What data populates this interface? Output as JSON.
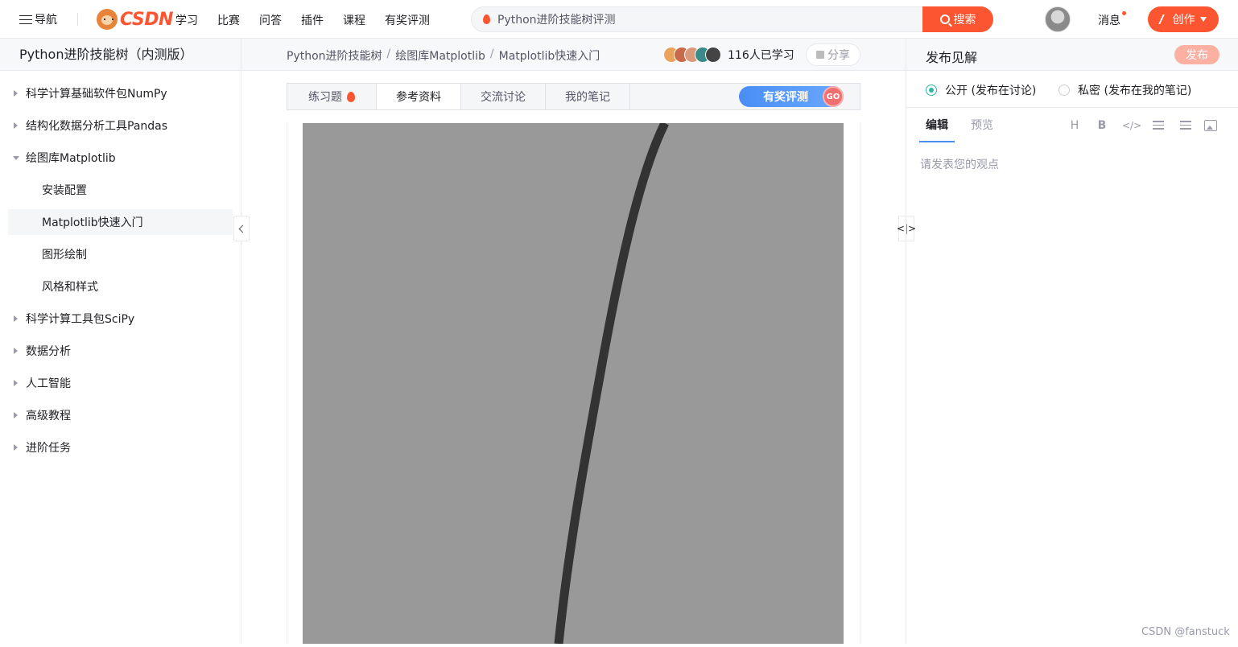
{
  "topbar": {
    "nav_label": "导航",
    "logo_text": "CSDN",
    "nav_links": [
      "学习",
      "比赛",
      "问答",
      "插件",
      "课程",
      "有奖评测"
    ],
    "search_value": "Python进阶技能树评测",
    "search_button": "搜索",
    "messages_label": "消息",
    "create_button": "创作",
    "accent_color": "#fc5531"
  },
  "sidebar": {
    "title": "Python进阶技能树（内测版）",
    "items": [
      {
        "label": "科学计算基础软件包NumPy",
        "level": 0,
        "expanded": false
      },
      {
        "label": "结构化数据分析工具Pandas",
        "level": 0,
        "expanded": false
      },
      {
        "label": "绘图库Matplotlib",
        "level": 0,
        "expanded": true
      },
      {
        "label": "安装配置",
        "level": 1
      },
      {
        "label": "Matplotlib快速入门",
        "level": 1,
        "active": true
      },
      {
        "label": "图形绘制",
        "level": 1
      },
      {
        "label": "风格和样式",
        "level": 1
      },
      {
        "label": "科学计算工具包SciPy",
        "level": 0,
        "expanded": false
      },
      {
        "label": "数据分析",
        "level": 0,
        "expanded": false
      },
      {
        "label": "人工智能",
        "level": 0,
        "expanded": false
      },
      {
        "label": "高级教程",
        "level": 0,
        "expanded": false
      },
      {
        "label": "进阶任务",
        "level": 0,
        "expanded": false
      }
    ]
  },
  "breadcrumb": {
    "items": [
      "Python进阶技能树",
      "绘图库Matplotlib",
      "Matplotlib快速入门"
    ],
    "separator": "/"
  },
  "learners": {
    "count_text": "116人已学习",
    "share_label": "分享"
  },
  "tabs": {
    "items": [
      "练习题",
      "参考资料",
      "交流讨论",
      "我的笔记"
    ],
    "active": "参考资料",
    "prize_label": "有奖评测",
    "prize_badge": "GO"
  },
  "plot": {
    "background_color": "#999999",
    "line_color": "#333333"
  },
  "right_panel": {
    "title": "发布见解",
    "publish_button": "发布",
    "visibility_options": [
      "公开 (发布在讨论)",
      "私密 (发布在我的笔记)"
    ],
    "selected_visibility": "公开 (发布在讨论)",
    "editor_tabs": [
      "编辑",
      "预览"
    ],
    "active_editor_tab": "编辑",
    "toolbar_icons": [
      "heading-icon",
      "bold-icon",
      "code-icon",
      "bullet-list-icon",
      "ordered-list-icon",
      "image-icon"
    ],
    "editor_placeholder": "请发表您的观点"
  },
  "watermark": "CSDN @fanstuck"
}
